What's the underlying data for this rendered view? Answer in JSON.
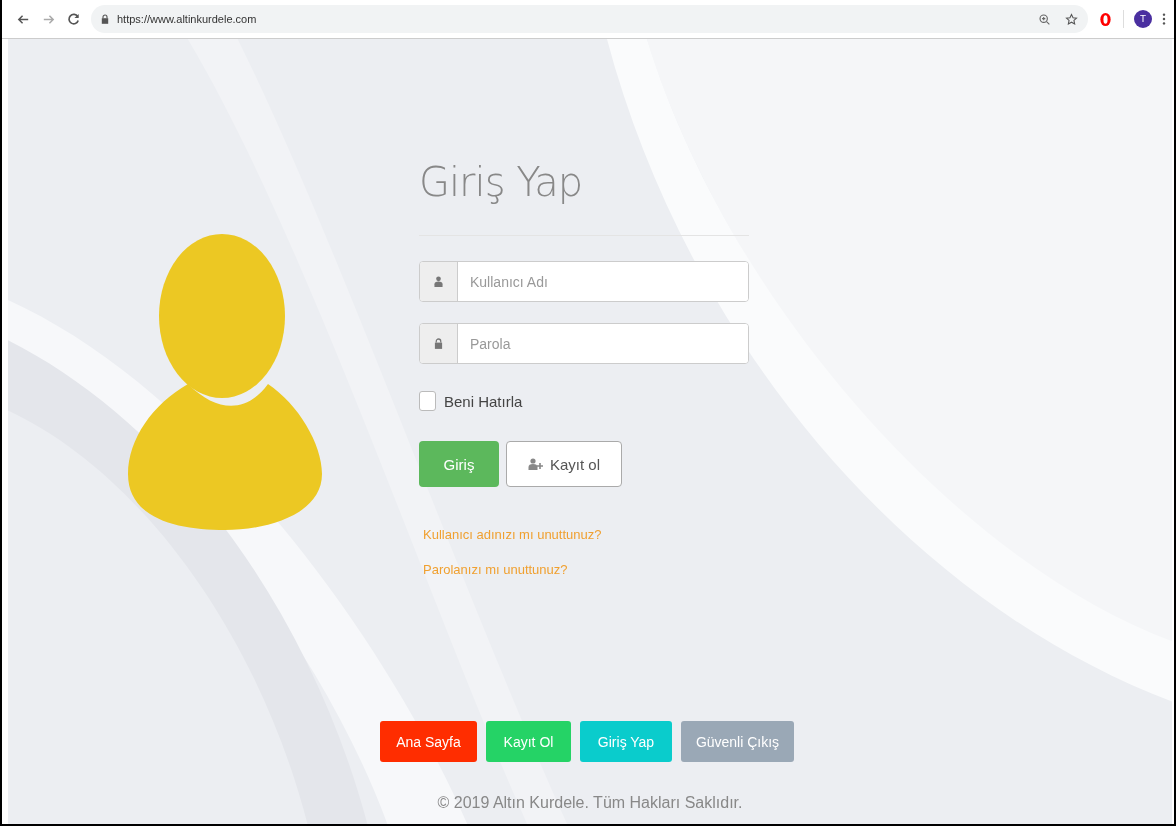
{
  "browser": {
    "url": "https://www.altinkurdele.com",
    "profile_initial": "T"
  },
  "login": {
    "title": "Giriş Yap",
    "username_placeholder": "Kullanıcı Adı",
    "password_placeholder": "Parola",
    "remember": {
      "label": "Beni Hatırla",
      "checked": false
    },
    "submit": "Giriş",
    "register": "Kayıt ol",
    "links": [
      "Kullanıcı adınızı mı unuttunuz?",
      "Parolanızı mı unuttunuz?"
    ]
  },
  "nav_buttons": [
    {
      "label": "Ana Sayfa",
      "color": "#ff2d00"
    },
    {
      "label": "Kayıt Ol",
      "color": "#25d366"
    },
    {
      "label": "Giriş Yap",
      "color": "#0acccc"
    },
    {
      "label": "Güvenli Çıkış",
      "color": "#9aa8b6"
    }
  ],
  "footer": "© 2019 Altın Kurdele. Tüm Hakları Saklıdır."
}
